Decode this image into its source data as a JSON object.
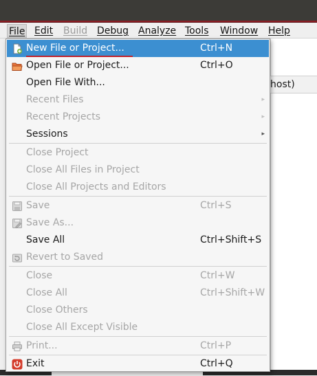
{
  "menubar": {
    "items": [
      {
        "label": "File",
        "state": "active"
      },
      {
        "label": "Edit",
        "state": "normal"
      },
      {
        "label": "Build",
        "state": "disabled"
      },
      {
        "label": "Debug",
        "state": "normal"
      },
      {
        "label": "Analyze",
        "state": "normal"
      },
      {
        "label": "Tools",
        "state": "normal"
      },
      {
        "label": "Window",
        "state": "normal"
      },
      {
        "label": "Help",
        "state": "normal"
      }
    ]
  },
  "background": {
    "header_text": "host)"
  },
  "file_menu": {
    "items": [
      {
        "label": "New File or Project...",
        "shortcut": "Ctrl+N",
        "icon": "new-file-icon",
        "state": "highlighted"
      },
      {
        "label": "Open File or Project...",
        "shortcut": "Ctrl+O",
        "icon": "open-folder-icon",
        "state": "enabled"
      },
      {
        "label": "Open File With...",
        "shortcut": "",
        "icon": "",
        "state": "enabled"
      },
      {
        "label": "Recent Files",
        "shortcut": "",
        "icon": "",
        "state": "disabled",
        "submenu": true
      },
      {
        "label": "Recent Projects",
        "shortcut": "",
        "icon": "",
        "state": "disabled",
        "submenu": true
      },
      {
        "label": "Sessions",
        "shortcut": "",
        "icon": "",
        "state": "enabled",
        "submenu": true
      },
      {
        "label": "Close Project",
        "shortcut": "",
        "icon": "",
        "state": "disabled"
      },
      {
        "label": "Close All Files in Project",
        "shortcut": "",
        "icon": "",
        "state": "disabled"
      },
      {
        "label": "Close All Projects and Editors",
        "shortcut": "",
        "icon": "",
        "state": "disabled"
      },
      {
        "label": "Save",
        "shortcut": "Ctrl+S",
        "icon": "save-icon",
        "state": "disabled"
      },
      {
        "label": "Save As...",
        "shortcut": "",
        "icon": "save-as-icon",
        "state": "disabled"
      },
      {
        "label": "Save All",
        "shortcut": "Ctrl+Shift+S",
        "icon": "",
        "state": "enabled"
      },
      {
        "label": "Revert to Saved",
        "shortcut": "",
        "icon": "revert-icon",
        "state": "disabled"
      },
      {
        "label": "Close",
        "shortcut": "Ctrl+W",
        "icon": "",
        "state": "disabled"
      },
      {
        "label": "Close All",
        "shortcut": "Ctrl+Shift+W",
        "icon": "",
        "state": "disabled"
      },
      {
        "label": "Close Others",
        "shortcut": "",
        "icon": "",
        "state": "disabled"
      },
      {
        "label": "Close All Except Visible",
        "shortcut": "",
        "icon": "",
        "state": "disabled"
      },
      {
        "label": "Print...",
        "shortcut": "Ctrl+P",
        "icon": "print-icon",
        "state": "disabled"
      },
      {
        "label": "Exit",
        "shortcut": "Ctrl+Q",
        "icon": "power-icon",
        "state": "enabled"
      }
    ],
    "submenu_arrow": "▸"
  },
  "colors": {
    "highlight": "#3c8fd1",
    "exit_icon": "#d43c2c",
    "title_accent": "#8b1e24"
  }
}
